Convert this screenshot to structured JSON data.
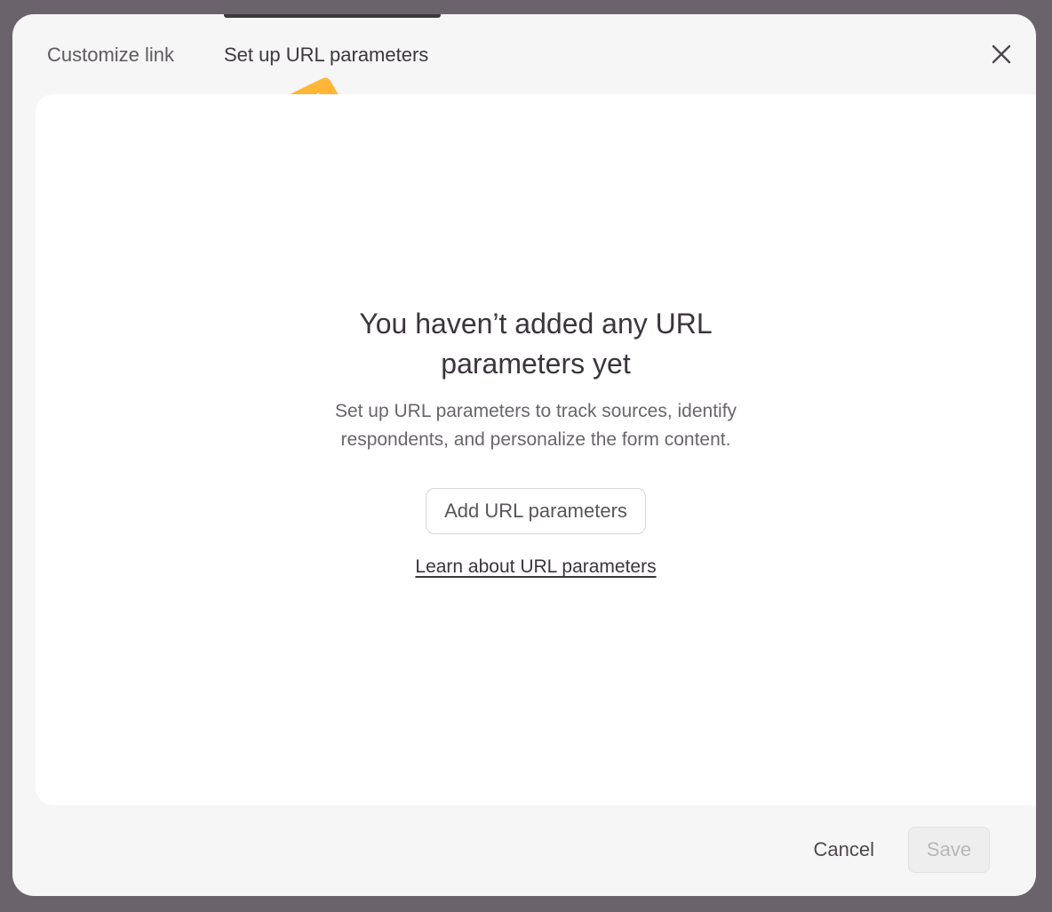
{
  "tabs": [
    {
      "label": "Customize link",
      "active": false
    },
    {
      "label": "Set up URL parameters",
      "active": true
    }
  ],
  "close_icon": "close-icon",
  "annotation": {
    "icon": "arrow-up-icon",
    "color": "#ffb636"
  },
  "empty_state": {
    "title": "You haven’t added any URL parameters yet",
    "description": "Set up URL parameters to track sources, identify respondents, and personalize the form content.",
    "add_button": "Add URL parameters",
    "learn_link": "Learn about URL parameters"
  },
  "footer": {
    "cancel_label": "Cancel",
    "save_label": "Save",
    "save_disabled": true
  }
}
